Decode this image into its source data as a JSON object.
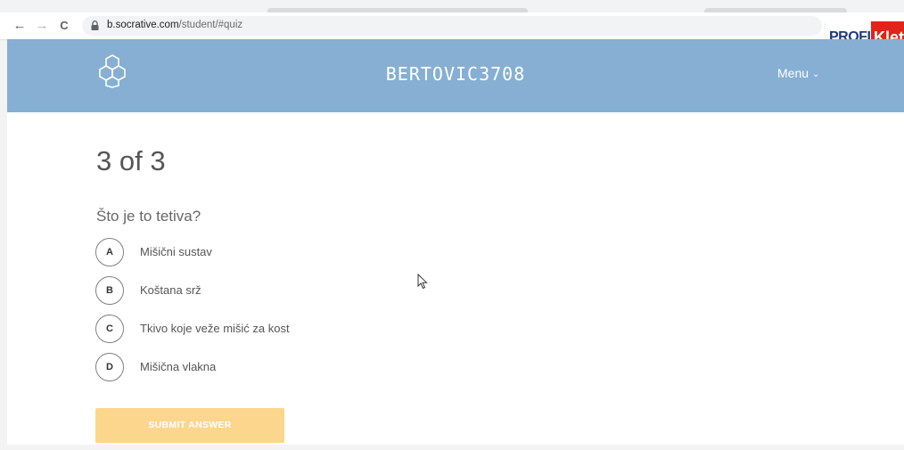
{
  "browser": {
    "url_host": "b.socrative.com",
    "url_path": "/student/#quiz",
    "nav": {
      "back_icon": "←",
      "forward_icon": "→",
      "reload_icon": "C"
    }
  },
  "brand": {
    "part1": "PROFIL",
    "part2": "Klett"
  },
  "header": {
    "room_name": "BERTOVIC3708",
    "menu_label": "Menu",
    "menu_chevron": "⌄"
  },
  "quiz": {
    "progress": "3 of 3",
    "question": "Što je to tetiva?",
    "options": [
      {
        "letter": "A",
        "text": "Mišični sustav"
      },
      {
        "letter": "B",
        "text": "Koštana srž"
      },
      {
        "letter": "C",
        "text": "Tkivo koje veže mišić za kost"
      },
      {
        "letter": "D",
        "text": "Mišična vlakna"
      }
    ],
    "submit_label": "SUBMIT ANSWER"
  },
  "colors": {
    "header_bg": "#86afd3",
    "submit_bg": "#fbd68c",
    "brand_red": "#e2231a",
    "brand_blue": "#1f3a7a"
  }
}
